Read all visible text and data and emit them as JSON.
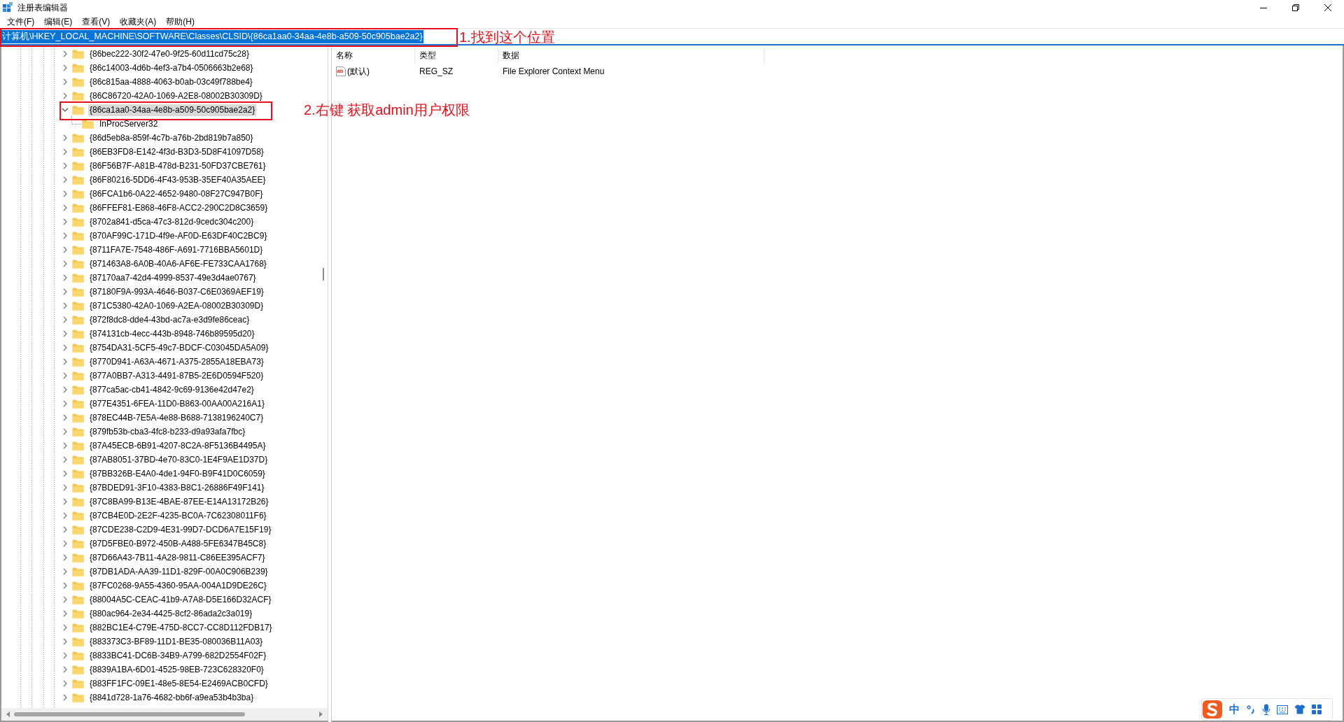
{
  "window": {
    "title": "注册表编辑器"
  },
  "menu": [
    "文件(F)",
    "编辑(E)",
    "查看(V)",
    "收藏夹(A)",
    "帮助(H)"
  ],
  "address_bar": {
    "value": "计算机\\HKEY_LOCAL_MACHINE\\SOFTWARE\\Classes\\CLSID\\{86ca1aa0-34aa-4e8b-a509-50c905bae2a2}",
    "selected": true
  },
  "tree": {
    "items": [
      {
        "name": "{86bec222-30f2-47e0-9f25-60d11cd75c28}",
        "expanded": false,
        "selected": false
      },
      {
        "name": "{86c14003-4d6b-4ef3-a7b4-0506663b2e68}",
        "expanded": false,
        "selected": false
      },
      {
        "name": "{86c815aa-4888-4063-b0ab-03c49f788be4}",
        "expanded": false,
        "selected": false
      },
      {
        "name": "{86C86720-42A0-1069-A2E8-08002B30309D}",
        "expanded": false,
        "selected": false
      },
      {
        "name": "{86ca1aa0-34aa-4e8b-a509-50c905bae2a2}",
        "expanded": true,
        "selected": true,
        "children": [
          {
            "name": "InProcServer32",
            "selected": false
          }
        ]
      },
      {
        "name": "{86d5eb8a-859f-4c7b-a76b-2bd819b7a850}",
        "expanded": false,
        "selected": false
      },
      {
        "name": "{86EB3FD8-E142-4f3d-B3D3-5D8F41097D58}",
        "expanded": false,
        "selected": false
      },
      {
        "name": "{86F56B7F-A81B-478d-B231-50FD37CBE761}",
        "expanded": false,
        "selected": false
      },
      {
        "name": "{86F80216-5DD6-4F43-953B-35EF40A35AEE}",
        "expanded": false,
        "selected": false
      },
      {
        "name": "{86FCA1b6-0A22-4652-9480-08F27C947B0F}",
        "expanded": false,
        "selected": false
      },
      {
        "name": "{86FFEF81-E868-46F8-ACC2-290C2D8C3659}",
        "expanded": false,
        "selected": false
      },
      {
        "name": "{8702a841-d5ca-47c3-812d-9cedc304c200}",
        "expanded": false,
        "selected": false
      },
      {
        "name": "{870AF99C-171D-4f9e-AF0D-E63DF40C2BC9}",
        "expanded": false,
        "selected": false
      },
      {
        "name": "{8711FA7E-7548-486F-A691-7716BBA5601D}",
        "expanded": false,
        "selected": false
      },
      {
        "name": "{871463A8-6A0B-40A6-AF6E-FE733CAA1768}",
        "expanded": false,
        "selected": false
      },
      {
        "name": "{87170aa7-42d4-4999-8537-49e3d4ae0767}",
        "expanded": false,
        "selected": false
      },
      {
        "name": "{87180F9A-993A-4646-B037-C6E0369AEF19}",
        "expanded": false,
        "selected": false
      },
      {
        "name": "{871C5380-42A0-1069-A2EA-08002B30309D}",
        "expanded": false,
        "selected": false
      },
      {
        "name": "{872f8dc8-dde4-43bd-ac7a-e3d9fe86ceac}",
        "expanded": false,
        "selected": false
      },
      {
        "name": "{874131cb-4ecc-443b-8948-746b89595d20}",
        "expanded": false,
        "selected": false
      },
      {
        "name": "{8754DA31-5CF5-49c7-BDCF-C03045DA5A09}",
        "expanded": false,
        "selected": false
      },
      {
        "name": "{8770D941-A63A-4671-A375-2855A18EBA73}",
        "expanded": false,
        "selected": false
      },
      {
        "name": "{877A0BB7-A313-4491-87B5-2E6D0594F520}",
        "expanded": false,
        "selected": false
      },
      {
        "name": "{877ca5ac-cb41-4842-9c69-9136e42d47e2}",
        "expanded": false,
        "selected": false
      },
      {
        "name": "{877E4351-6FEA-11D0-B863-00AA00A216A1}",
        "expanded": false,
        "selected": false
      },
      {
        "name": "{878EC44B-7E5A-4e88-B688-7138196240C7}",
        "expanded": false,
        "selected": false
      },
      {
        "name": "{879fb53b-cba3-4fc8-b233-d9a93afa7fbc}",
        "expanded": false,
        "selected": false
      },
      {
        "name": "{87A45ECB-6B91-4207-8C2A-8F5136B4495A}",
        "expanded": false,
        "selected": false
      },
      {
        "name": "{87AB8051-37BD-4e70-83C0-1E4F9AE1D37D}",
        "expanded": false,
        "selected": false
      },
      {
        "name": "{87BB326B-E4A0-4de1-94F0-B9F41D0C6059}",
        "expanded": false,
        "selected": false
      },
      {
        "name": "{87BDED91-3F10-4383-B8C1-26886F49F141}",
        "expanded": false,
        "selected": false
      },
      {
        "name": "{87C8BA99-B13E-4BAE-87EE-E14A13172B26}",
        "expanded": false,
        "selected": false
      },
      {
        "name": "{87CB4E0D-2E2F-4235-BC0A-7C62308011F6}",
        "expanded": false,
        "selected": false
      },
      {
        "name": "{87CDE238-C2D9-4E31-99D7-DCD6A7E15F19}",
        "expanded": false,
        "selected": false
      },
      {
        "name": "{87D5FBE0-B972-450B-A488-5FE6347B45C8}",
        "expanded": false,
        "selected": false
      },
      {
        "name": "{87D66A43-7B11-4A28-9811-C86EE395ACF7}",
        "expanded": false,
        "selected": false
      },
      {
        "name": "{87DB1ADA-AA39-11D1-829F-00A0C906B239}",
        "expanded": false,
        "selected": false
      },
      {
        "name": "{87FC0268-9A55-4360-95AA-004A1D9DE26C}",
        "expanded": false,
        "selected": false
      },
      {
        "name": "{88004A5C-CEAC-41b9-A7A8-D5E166D32ACF}",
        "expanded": false,
        "selected": false
      },
      {
        "name": "{880ac964-2e34-4425-8cf2-86ada2c3a019}",
        "expanded": false,
        "selected": false
      },
      {
        "name": "{882BC1E4-C79E-475D-8CC7-CC8D112FDB17}",
        "expanded": false,
        "selected": false
      },
      {
        "name": "{883373C3-BF89-11D1-BE35-080036B11A03}",
        "expanded": false,
        "selected": false
      },
      {
        "name": "{8833BC41-DC6B-34B9-A799-682D2554F02F}",
        "expanded": false,
        "selected": false
      },
      {
        "name": "{8839A1BA-6D01-4525-98EB-723C628320F0}",
        "expanded": false,
        "selected": false
      },
      {
        "name": "{883FF1FC-09E1-48e5-8E54-E2469ACB0CFD}",
        "expanded": false,
        "selected": false
      },
      {
        "name": "{8841d728-1a76-4682-bb6f-a9ea53b4b3ba}",
        "expanded": false,
        "selected": false
      }
    ]
  },
  "values": {
    "columns": [
      "名称",
      "类型",
      "数据"
    ],
    "rows": [
      {
        "kind": "string",
        "icon": "ab",
        "name": "(默认)",
        "type": "REG_SZ",
        "data": "File Explorer Context Menu"
      }
    ]
  },
  "annotations": [
    {
      "kind": "address",
      "text": "1.找到这个位置"
    },
    {
      "kind": "key",
      "text": "2.右键 获取admin用户权限"
    }
  ],
  "ime_toolbar": {
    "mode": "中"
  }
}
